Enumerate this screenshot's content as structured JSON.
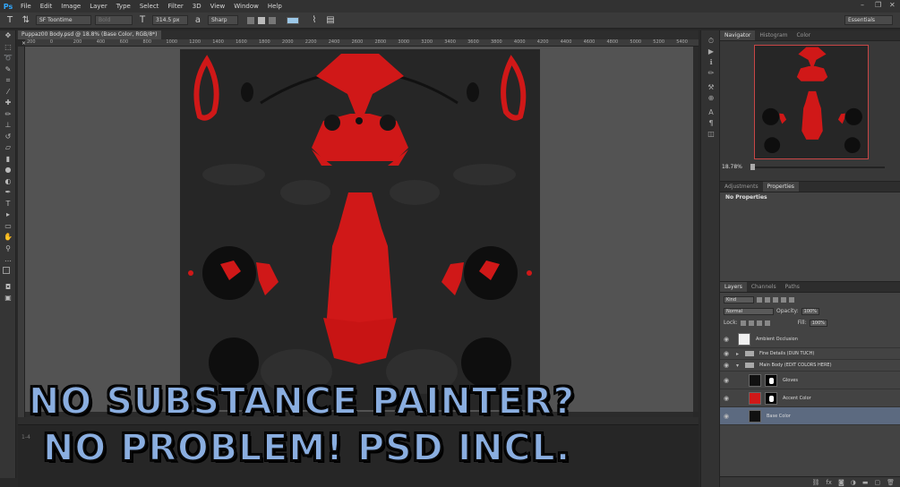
{
  "app": {
    "logo": "Ps"
  },
  "menu": [
    "File",
    "Edit",
    "Image",
    "Layer",
    "Type",
    "Select",
    "Filter",
    "3D",
    "View",
    "Window",
    "Help"
  ],
  "options": {
    "font_family": "SF Toontime",
    "font_style": "Bold",
    "font_size": "314.5 px",
    "antialias": "Sharp",
    "text_color": "#9cc8e8",
    "workspace": "Essentials"
  },
  "document": {
    "tab_title": "Puppaz00 Body.psd @ 18.8% (Base Color, RGB/8*)",
    "ruler_ticks": [
      "200",
      "0",
      "200",
      "400",
      "600",
      "800",
      "1000",
      "1200",
      "1400",
      "1600",
      "1800",
      "2000",
      "2200",
      "2400",
      "2600",
      "2800",
      "3000",
      "3200",
      "3400",
      "3600",
      "3800",
      "4000",
      "4200",
      "4400",
      "4600",
      "4800",
      "5000",
      "5200",
      "5400",
      "5600"
    ],
    "status": "",
    "timeline_handle": "1-4"
  },
  "overlay": {
    "line1": "NO SUBSTANCE PAINTER?",
    "line2": "NO PROBLEM! PSD INCL."
  },
  "navigator": {
    "tabs": [
      "Navigator",
      "Histogram",
      "Color"
    ],
    "zoom": "18.78%"
  },
  "properties": {
    "tabs": [
      "Adjustments",
      "Properties"
    ],
    "empty_label": "No Properties"
  },
  "layers_panel": {
    "tabs": [
      "Layers",
      "Channels",
      "Paths"
    ],
    "filter": "Kind",
    "blend_mode": "Normal",
    "opacity_label": "Opacity:",
    "opacity": "100%",
    "lock_label": "Lock:",
    "fill_label": "Fill:",
    "fill": "100%",
    "layers": [
      {
        "name": "Ambient Occlusion",
        "type": "layer",
        "thumb": "white"
      },
      {
        "name": "Fine Details (DUN TUCH)",
        "type": "group"
      },
      {
        "name": "Main Body (EDIT COLORS HERE)",
        "type": "group-open"
      },
      {
        "name": "Gloves",
        "type": "layer",
        "thumb": "black",
        "mask": true
      },
      {
        "name": "Accent Color",
        "type": "layer",
        "thumb": "red",
        "mask": true
      },
      {
        "name": "Base Color",
        "type": "layer",
        "thumb": "black",
        "selected": true
      }
    ]
  },
  "colors": {
    "accent_red": "#d01818",
    "texture_bg": "#262626",
    "overlay_text": "#8aaee0"
  }
}
